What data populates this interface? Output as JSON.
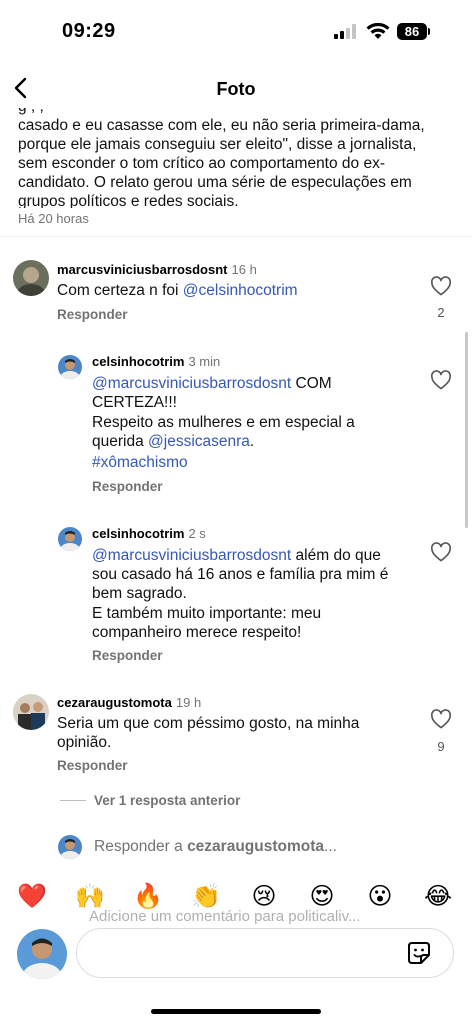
{
  "status_bar": {
    "time": "09:29",
    "battery": "86"
  },
  "header": {
    "title": "Foto"
  },
  "caption": {
    "lines": [
      "g                    ,             ,",
      "casado e eu casasse com ele, eu não seria primeira-dama,",
      "porque ele jamais conseguiu ser eleito\", disse a jornalista,",
      "sem esconder o tom crítico ao comportamento do ex-",
      "candidato. O relato gerou uma série de especulações em",
      "grupos políticos e redes sociais."
    ],
    "time": "Há 20 horas"
  },
  "comments": [
    {
      "username": "marcusviniciusbarrosdosnt",
      "ago": "16 h",
      "text": "Com certeza n foi ",
      "mention": "@celsinhocotrim",
      "reply_label": "Responder",
      "likes": "2"
    },
    {
      "username": "celsinhocotrim",
      "ago": "3 min",
      "mention": "@marcusviniciusbarrosdosnt",
      "text1": " COM CERTEZA!!!",
      "text2": "Respeito as mulheres e em especial a querida ",
      "mention2": "@jessicasenra",
      "text2_end": ".",
      "hashtag": "#xômachismo",
      "reply_label": "Responder"
    },
    {
      "username": "celsinhocotrim",
      "ago": "2 s",
      "mention": "@marcusviniciusbarrosdosnt",
      "text1": " além do que sou casado há 16 anos e família pra mim é bem sagrado.",
      "text2": "E também muito importante: meu companheiro merece respeito!",
      "reply_label": "Responder"
    },
    {
      "username": "cezaraugustomota",
      "ago": "19 h",
      "text": "Seria um que com péssimo gosto, na minha opinião.",
      "reply_label": "Responder",
      "likes": "9"
    }
  ],
  "view_previous": "Ver 1 resposta anterior",
  "replying_to": {
    "prefix": "Responder a ",
    "user": "cezaraugustomota",
    "suffix": "..."
  },
  "emojis": [
    "❤️",
    "🙌",
    "🔥",
    "👏",
    "😢",
    "😍",
    "😮",
    "😂"
  ],
  "input": {
    "placeholder": "Adicione um comentário para politicaliv..."
  },
  "colors": {
    "mention": "#3558b8",
    "muted": "#737373",
    "heart": "#ff3040"
  }
}
